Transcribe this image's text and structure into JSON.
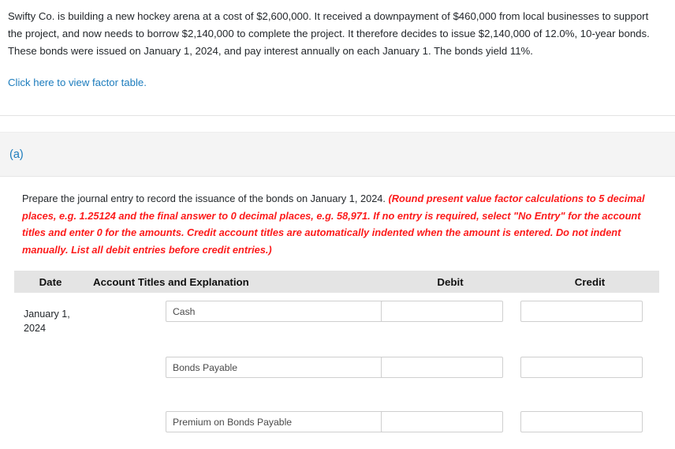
{
  "problem": {
    "statement": "Swifty Co. is building a new hockey arena at a cost of $2,600,000. It received a downpayment of $460,000 from local businesses to support the project, and now needs to borrow $2,140,000 to complete the project. It therefore decides to issue $2,140,000 of 12.0%, 10-year bonds. These bonds were issued on January 1, 2024, and pay interest annually on each January 1. The bonds yield 11%.",
    "factor_table_link": "Click here to view factor table."
  },
  "part": {
    "label": "(a)",
    "instruction_plain": "Prepare the journal entry to record the issuance of the bonds on January 1, 2024. ",
    "instruction_emphasis": "(Round present value factor calculations to 5 decimal places, e.g. 1.25124 and the final answer to 0 decimal places, e.g. 58,971. If no entry is required, select \"No Entry\" for the account titles and enter 0 for the amounts. Credit account titles are automatically indented when the amount is entered. Do not indent manually. List all debit entries before credit entries.)"
  },
  "journal": {
    "headers": {
      "date": "Date",
      "account": "Account Titles and Explanation",
      "debit": "Debit",
      "credit": "Credit"
    },
    "rows": [
      {
        "date": "January 1, 2024",
        "account_value": "Cash",
        "account_placeholder": "",
        "debit_value": "",
        "credit_value": ""
      },
      {
        "date": "",
        "account_value": "Bonds Payable",
        "account_placeholder": "",
        "debit_value": "",
        "credit_value": ""
      },
      {
        "date": "",
        "account_value": "Premium on Bonds Payable",
        "account_placeholder": "",
        "debit_value": "",
        "credit_value": ""
      }
    ]
  },
  "colors": {
    "link": "#1c7cbd",
    "emphasis": "#fc1b1b",
    "header_band": "#e4e4e4",
    "part_band": "#f4f4f4"
  }
}
